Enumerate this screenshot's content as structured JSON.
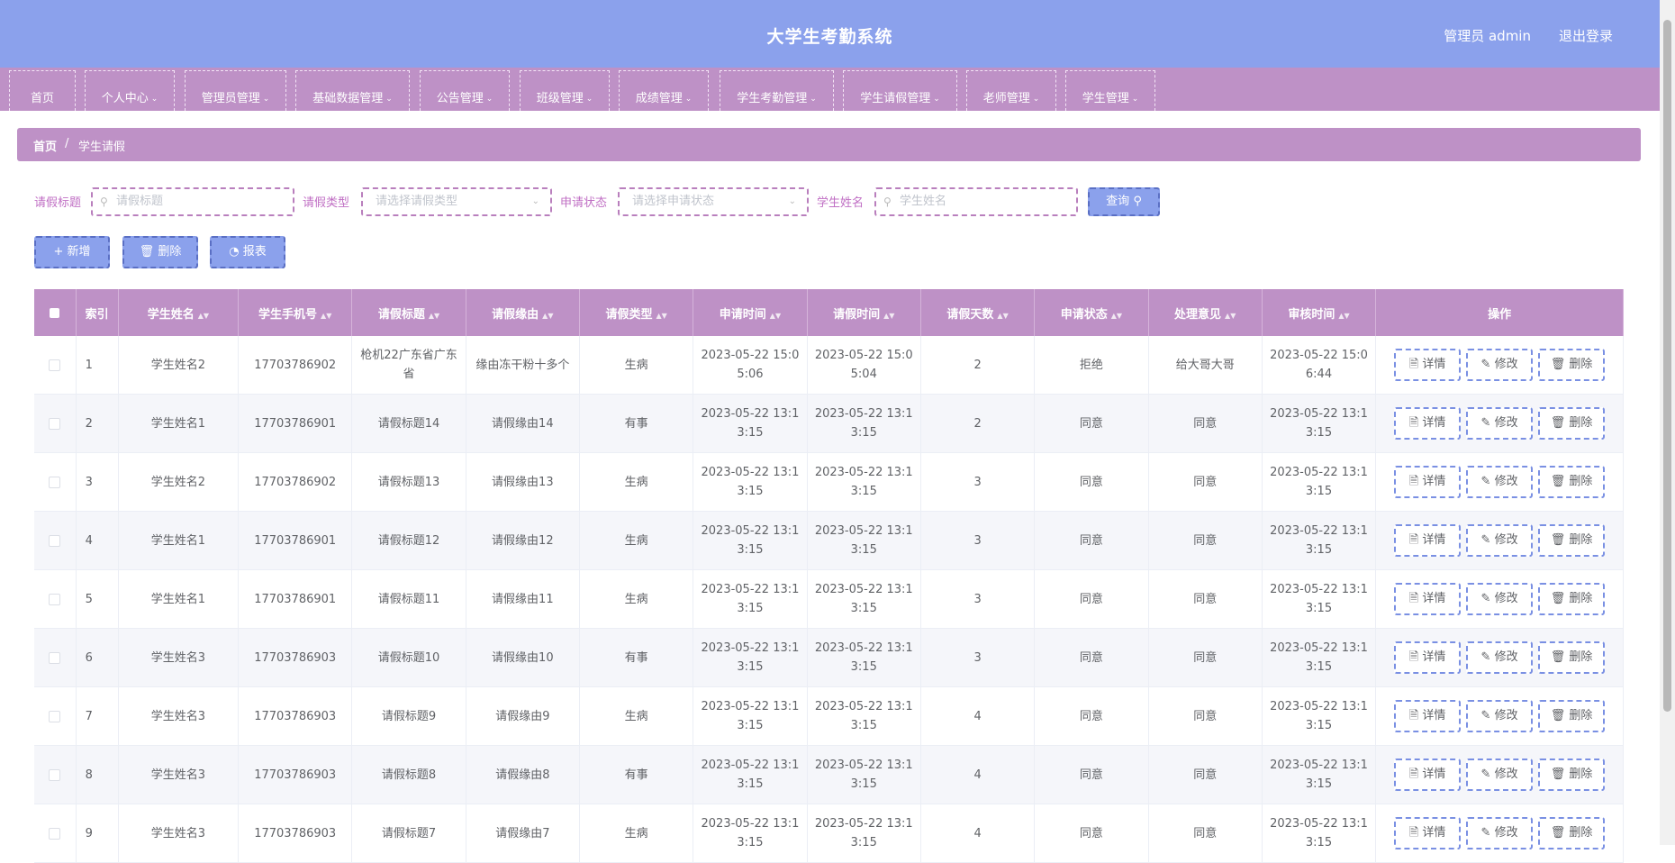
{
  "header": {
    "title": "大学生考勤系统",
    "user": "管理员 admin",
    "logout": "退出登录"
  },
  "nav": [
    "首页",
    "个人中心",
    "管理员管理",
    "基础数据管理",
    "公告管理",
    "班级管理",
    "成绩管理",
    "学生考勤管理",
    "学生请假管理",
    "老师管理",
    "学生管理"
  ],
  "breadcrumb": {
    "home": "首页",
    "separator": "/",
    "current": "学生请假"
  },
  "search": {
    "title_label": "请假标题",
    "title_placeholder": "请假标题",
    "type_label": "请假类型",
    "type_placeholder": "请选择请假类型",
    "status_label": "申请状态",
    "status_placeholder": "请选择申请状态",
    "name_label": "学生姓名",
    "name_placeholder": "学生姓名",
    "query_label": "查询"
  },
  "actions": {
    "add": "新增",
    "delete": "删除",
    "report": "报表"
  },
  "table": {
    "headers": [
      "索引",
      "学生姓名",
      "学生手机号",
      "请假标题",
      "请假缘由",
      "请假类型",
      "申请时间",
      "请假时间",
      "请假天数",
      "申请状态",
      "处理意见",
      "审核时间",
      "操作"
    ],
    "row_actions": {
      "detail": "详情",
      "edit": "修改",
      "delete": "删除"
    },
    "rows": [
      [
        "1",
        "学生姓名2",
        "17703786902",
        "枪机22广东省广东省",
        "缘由冻干粉十多个",
        "生病",
        "2023-05-22 15:05:06",
        "2023-05-22 15:05:04",
        "2",
        "拒绝",
        "给大哥大哥",
        "2023-05-22 15:06:44"
      ],
      [
        "2",
        "学生姓名1",
        "17703786901",
        "请假标题14",
        "请假缘由14",
        "有事",
        "2023-05-22 13:13:15",
        "2023-05-22 13:13:15",
        "2",
        "同意",
        "同意",
        "2023-05-22 13:13:15"
      ],
      [
        "3",
        "学生姓名2",
        "17703786902",
        "请假标题13",
        "请假缘由13",
        "生病",
        "2023-05-22 13:13:15",
        "2023-05-22 13:13:15",
        "3",
        "同意",
        "同意",
        "2023-05-22 13:13:15"
      ],
      [
        "4",
        "学生姓名1",
        "17703786901",
        "请假标题12",
        "请假缘由12",
        "生病",
        "2023-05-22 13:13:15",
        "2023-05-22 13:13:15",
        "3",
        "同意",
        "同意",
        "2023-05-22 13:13:15"
      ],
      [
        "5",
        "学生姓名1",
        "17703786901",
        "请假标题11",
        "请假缘由11",
        "生病",
        "2023-05-22 13:13:15",
        "2023-05-22 13:13:15",
        "3",
        "同意",
        "同意",
        "2023-05-22 13:13:15"
      ],
      [
        "6",
        "学生姓名3",
        "17703786903",
        "请假标题10",
        "请假缘由10",
        "有事",
        "2023-05-22 13:13:15",
        "2023-05-22 13:13:15",
        "3",
        "同意",
        "同意",
        "2023-05-22 13:13:15"
      ],
      [
        "7",
        "学生姓名3",
        "17703786903",
        "请假标题9",
        "请假缘由9",
        "生病",
        "2023-05-22 13:13:15",
        "2023-05-22 13:13:15",
        "4",
        "同意",
        "同意",
        "2023-05-22 13:13:15"
      ],
      [
        "8",
        "学生姓名3",
        "17703786903",
        "请假标题8",
        "请假缘由8",
        "有事",
        "2023-05-22 13:13:15",
        "2023-05-22 13:13:15",
        "4",
        "同意",
        "同意",
        "2023-05-22 13:13:15"
      ],
      [
        "9",
        "学生姓名3",
        "17703786903",
        "请假标题7",
        "请假缘由7",
        "生病",
        "2023-05-22 13:13:15",
        "2023-05-22 13:13:15",
        "4",
        "同意",
        "同意",
        "2023-05-22 13:13:15"
      ]
    ]
  },
  "colors": {
    "header": "#8ba1ec",
    "nav": "#be91c6",
    "label": "#c06fc4",
    "button": "#8ba1ec"
  }
}
